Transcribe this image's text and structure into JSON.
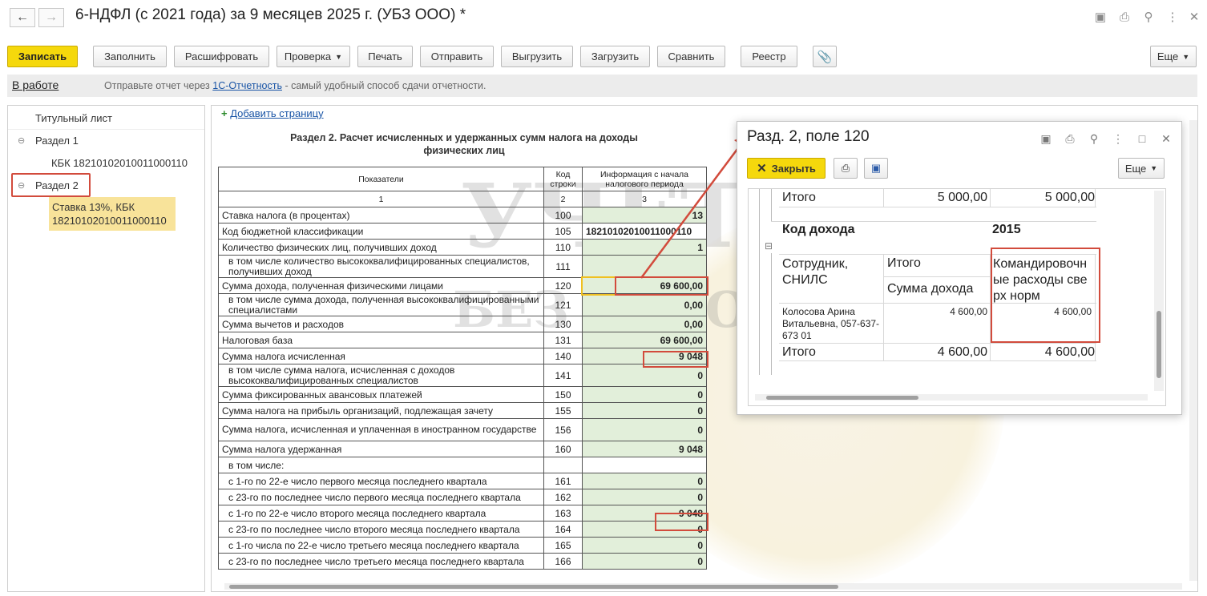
{
  "window": {
    "title": "6-НДФЛ (с 2021 года) за 9 месяцев 2025 г. (УБЗ ООО) *"
  },
  "toolbar": {
    "save": "Записать",
    "fill": "Заполнить",
    "decode": "Расшифровать",
    "check": "Проверка",
    "print": "Печать",
    "send": "Отправить",
    "upload": "Выгрузить",
    "load": "Загрузить",
    "compare": "Сравнить",
    "registry": "Реестр",
    "more": "Еще"
  },
  "status": {
    "state": "В работе",
    "message_pre": "Отправьте отчет через ",
    "message_link": "1С-Отчетность",
    "message_post": " - самый удобный способ сдачи отчетности."
  },
  "tree": {
    "title_page": "Титульный лист",
    "section1": "Раздел 1",
    "kbk1": "КБК 18210102010011000110",
    "section2": "Раздел 2",
    "rate_line1": "Ставка 13%, КБК",
    "rate_line2": "18210102010011000110"
  },
  "report": {
    "add_page": "Добавить страницу",
    "heading_line1": "Раздел 2. Расчет исчисленных и удержанных сумм налога на доходы",
    "heading_line2": "физических лиц",
    "col_indicators": "Показатели",
    "col_code": "Код строки",
    "col_info": "Информация с начала налогового периода",
    "num1": "1",
    "num2": "2",
    "num3": "3",
    "rows": [
      {
        "label": "Ставка налога (в процентах)",
        "code": "100",
        "value": "13"
      },
      {
        "label": "Код бюджетной классификации",
        "code": "105",
        "value": "18210102010011000110"
      },
      {
        "label": "Количество физических лиц, получивших доход",
        "code": "110",
        "value": "1"
      },
      {
        "label": "в том числе количество высококвалифицированных специалистов, получивших доход",
        "code": "111",
        "value": ""
      },
      {
        "label": "Сумма дохода, полученная физическими лицами",
        "code": "120",
        "value": "69 600,00"
      },
      {
        "label": "в том числе сумма дохода, полученная высококвалифицированными специалистами",
        "code": "121",
        "value": "0,00"
      },
      {
        "label": "Сумма вычетов и расходов",
        "code": "130",
        "value": "0,00"
      },
      {
        "label": "Налоговая база",
        "code": "131",
        "value": "69 600,00"
      },
      {
        "label": "Сумма налога исчисленная",
        "code": "140",
        "value": "9 048"
      },
      {
        "label": "в том числе сумма налога, исчисленная с доходов высококвалифицированных специалистов",
        "code": "141",
        "value": "0"
      },
      {
        "label": "Сумма фиксированных авансовых платежей",
        "code": "150",
        "value": "0"
      },
      {
        "label": "Сумма налога на прибыль организаций, подлежащая зачету",
        "code": "155",
        "value": "0"
      },
      {
        "label": "Сумма налога, исчисленная и уплаченная в иностранном государстве",
        "code": "156",
        "value": "0"
      },
      {
        "label": "Сумма налога удержанная",
        "code": "160",
        "value": "9 048"
      },
      {
        "label": "в том числе:",
        "code": "",
        "value": ""
      },
      {
        "label": "с 1-го по 22-е число первого месяца последнего квартала",
        "code": "161",
        "value": "0"
      },
      {
        "label": "с 23-го по последнее число первого месяца последнего квартала",
        "code": "162",
        "value": "0"
      },
      {
        "label": "с 1-го по 22-е число второго месяца последнего квартала",
        "code": "163",
        "value": "9 048"
      },
      {
        "label": "с 23-го по последнее число второго месяца последнего квартала",
        "code": "164",
        "value": "0"
      },
      {
        "label": "с 1-го числа по 22-е число третьего месяца последнего квартала",
        "code": "165",
        "value": "0"
      },
      {
        "label": "с 23-го по последнее число третьего месяца последнего квартала",
        "code": "166",
        "value": "0"
      }
    ]
  },
  "watermark": {
    "line1": "УЧЕТ",
    "line2": "БЕЗ ЗАБОТ"
  },
  "dialog": {
    "title": "Разд. 2, поле 120",
    "close": "Закрыть",
    "more": "Еще",
    "total_top": "Итого",
    "total_top_v1": "5 000,00",
    "total_top_v2": "5 000,00",
    "income_code_label": "Код дохода",
    "income_code_value": "2015",
    "employee_label": "Сотрудник, СНИЛС",
    "total_label": "Итого",
    "income_sum_label": "Сумма дохода",
    "category_label": "Командировочные расходы сверх норм",
    "employee_name": "Колосова Арина Витальевна, 057-637-673 01",
    "employee_v1": "4 600,00",
    "employee_v2": "4 600,00",
    "total_bottom": "Итого",
    "total_bottom_v1": "4 600,00",
    "total_bottom_v2": "4 600,00"
  }
}
